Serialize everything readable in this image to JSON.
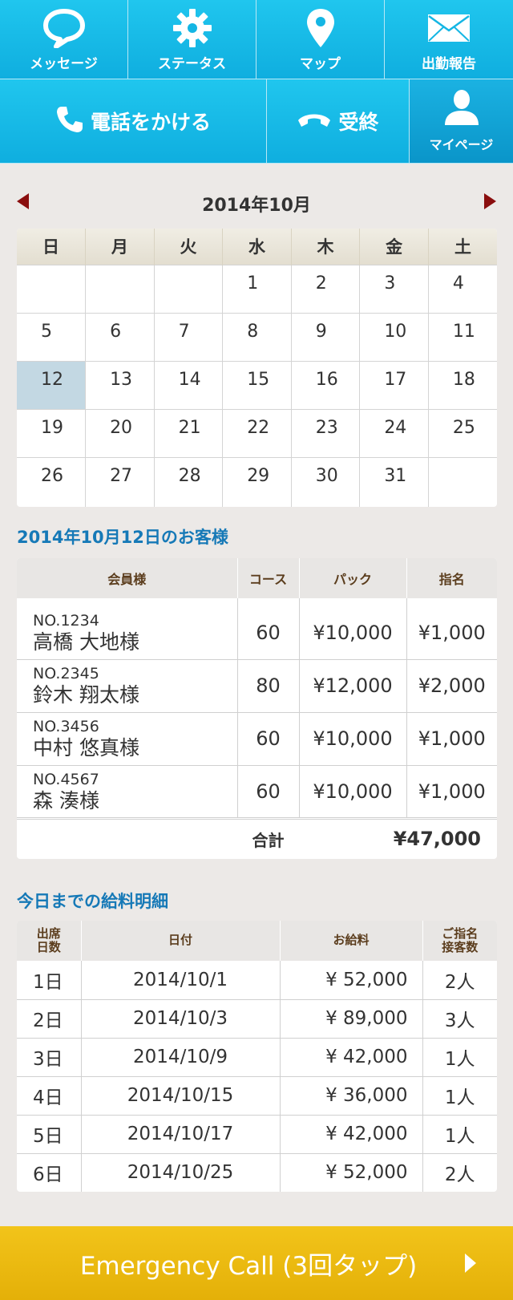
{
  "nav": {
    "message": "メッセージ",
    "status": "ステータス",
    "map": "マップ",
    "attendance": "出勤報告",
    "call": "電話をかける",
    "hangup": "受終",
    "mypage": "マイページ"
  },
  "calendar": {
    "title": "2014年10月",
    "weekdays": [
      "日",
      "月",
      "火",
      "水",
      "木",
      "金",
      "土"
    ],
    "weeks": [
      [
        "",
        "",
        "",
        "1",
        "2",
        "3",
        "4"
      ],
      [
        "5",
        "6",
        "7",
        "8",
        "9",
        "10",
        "11"
      ],
      [
        "12",
        "13",
        "14",
        "15",
        "16",
        "17",
        "18"
      ],
      [
        "19",
        "20",
        "21",
        "22",
        "23",
        "24",
        "25"
      ],
      [
        "26",
        "27",
        "28",
        "29",
        "30",
        "31",
        ""
      ]
    ],
    "selected": "12"
  },
  "customers": {
    "title": "2014年10月12日のお客様",
    "headers": [
      "会員様",
      "コース",
      "パック",
      "指名"
    ],
    "rows": [
      {
        "no": "NO.1234",
        "name": "高橋 大地様",
        "course": "60",
        "pack": "¥10,000",
        "nomination": "¥1,000"
      },
      {
        "no": "NO.2345",
        "name": "鈴木 翔太様",
        "course": "80",
        "pack": "¥12,000",
        "nomination": "¥2,000"
      },
      {
        "no": "NO.3456",
        "name": "中村 悠真様",
        "course": "60",
        "pack": "¥10,000",
        "nomination": "¥1,000"
      },
      {
        "no": "NO.4567",
        "name": "森 湊様",
        "course": "60",
        "pack": "¥10,000",
        "nomination": "¥1,000"
      }
    ],
    "total_label": "合計",
    "total_value": "¥47,000"
  },
  "salary": {
    "title": "今日までの給料明細",
    "headers": [
      "出席\n日数",
      "日付",
      "お給料",
      "ご指名\n接客数"
    ],
    "rows": [
      {
        "day": "1日",
        "date": "2014/10/1",
        "pay": "¥ 52,000",
        "count": "2人"
      },
      {
        "day": "2日",
        "date": "2014/10/3",
        "pay": "¥ 89,000",
        "count": "3人"
      },
      {
        "day": "3日",
        "date": "2014/10/9",
        "pay": "¥ 42,000",
        "count": "1人"
      },
      {
        "day": "4日",
        "date": "2014/10/15",
        "pay": "¥ 36,000",
        "count": "1人"
      },
      {
        "day": "5日",
        "date": "2014/10/17",
        "pay": "¥ 42,000",
        "count": "1人"
      },
      {
        "day": "6日",
        "date": "2014/10/25",
        "pay": "¥ 52,000",
        "count": "2人"
      }
    ]
  },
  "emergency": {
    "label": "Emergency Call (3回タップ)"
  },
  "colors": {
    "nav_blue": "#1bbbe9",
    "section_title": "#1679b7",
    "header_text": "#5b3d1d",
    "selected_day": "#c3d8e3",
    "arrow": "#8a0e0e",
    "emergency": "#ecbb10"
  },
  "icons": {
    "message": "speech-bubble-icon",
    "status": "gear-icon",
    "map": "map-pin-icon",
    "attendance": "envelope-icon",
    "call": "phone-icon",
    "hangup": "hangup-phone-icon",
    "mypage": "person-icon"
  }
}
